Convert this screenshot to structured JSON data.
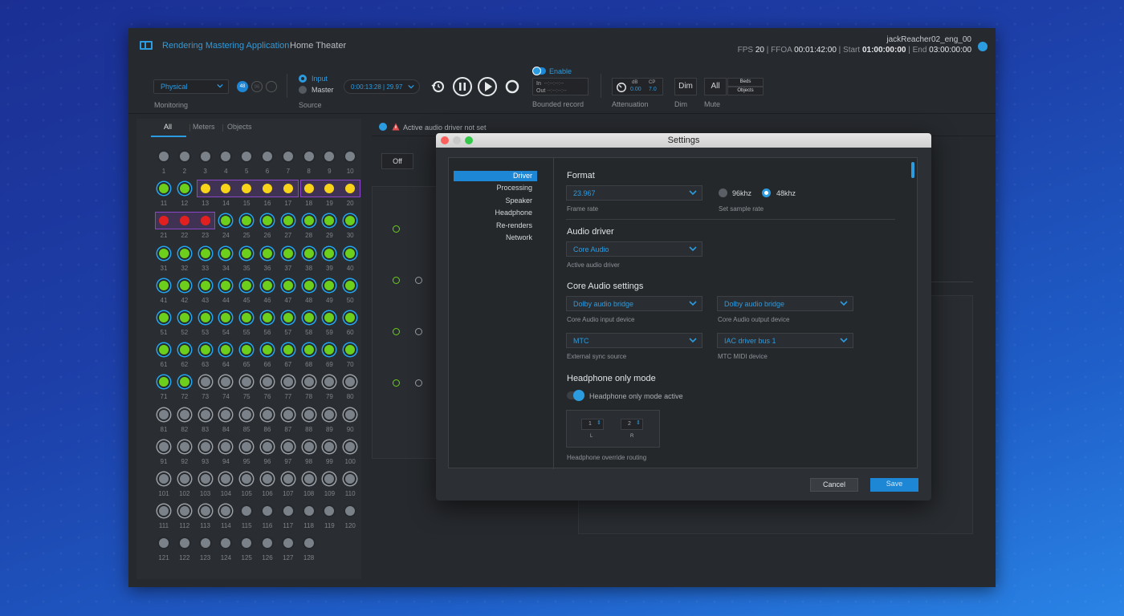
{
  "app": {
    "title": "Rendering Mastering Application",
    "mode": "Home Theater",
    "project": "jackReacher02_eng_00",
    "fps_label": "FPS",
    "fps": "20",
    "ffoa_label": "FFOA",
    "ffoa": "00:01:42:00",
    "start_label": "Start",
    "start": "01:00:00:00",
    "end_label": "End",
    "end": "03:00:00:00"
  },
  "toolbar": {
    "monitoring_value": "Physical",
    "monitoring_label": "Monitoring",
    "rate_badges": [
      "48",
      "96",
      "·"
    ],
    "source_input": "Input",
    "source_master": "Master",
    "source_label": "Source",
    "timecode": "0:00:13:28 | 29.97",
    "enable_label": "Enable",
    "in_label": "In",
    "in_value": "--:--:--:--",
    "out_label": "Out",
    "out_value": "--:--:--:--",
    "bounded_label": "Bounded record",
    "atten_db_label": "dB",
    "atten_db": "0.00",
    "atten_cp_label": "CP",
    "atten_cp": "7.0",
    "attenuation_label": "Attenuation",
    "dim_button": "Dim",
    "dim_label": "Dim",
    "all_button": "All",
    "beds_label": "Beds",
    "objects_label": "Objects",
    "mute_label": "Mute"
  },
  "left_tabs": [
    "All",
    "Meters",
    "Objects"
  ],
  "notice": "Active audio driver not set",
  "off_button": "Off",
  "channels": {
    "plain": [
      1,
      2,
      3,
      4,
      5,
      6,
      7,
      8,
      9,
      10,
      115,
      116,
      117,
      118,
      119,
      120,
      121,
      122,
      123,
      124,
      125,
      126,
      127,
      128
    ],
    "green": [
      11,
      12,
      24,
      25,
      26,
      27,
      28,
      29,
      30,
      31,
      32,
      33,
      34,
      35,
      36,
      37,
      38,
      39,
      40,
      41,
      42,
      43,
      44,
      45,
      46,
      47,
      48,
      49,
      50,
      51,
      52,
      53,
      54,
      55,
      56,
      57,
      58,
      59,
      60,
      61,
      62,
      63,
      64,
      65,
      66,
      67,
      68,
      69,
      70,
      71,
      72
    ],
    "yellow": [
      13,
      14,
      15,
      16,
      17,
      18,
      19,
      20
    ],
    "red": [
      21,
      22,
      23
    ],
    "count": 128
  },
  "settings": {
    "title": "Settings",
    "nav": [
      "Driver",
      "Processing",
      "Speaker",
      "Headphone",
      "Re-renders",
      "Network"
    ],
    "format_heading": "Format",
    "frame_rate_value": "23.967",
    "frame_rate_label": "Frame rate",
    "rate_96": "96khz",
    "rate_48": "48khz",
    "sample_rate_label": "Set sample rate",
    "audio_driver_heading": "Audio driver",
    "audio_driver_value": "Core Audio",
    "audio_driver_label": "Active audio driver",
    "core_heading": "Core Audio settings",
    "input_device_value": "Dolby audio bridge",
    "input_device_label": "Core Audio input device",
    "output_device_value": "Dolby audio bridge",
    "output_device_label": "Core Audio output device",
    "sync_value": "MTC",
    "sync_label": "External sync source",
    "midi_value": "IAC driver bus 1",
    "midi_label": "MTC MIDI device",
    "headphone_heading": "Headphone only mode",
    "headphone_toggle_label": "Headphone only mode active",
    "routing_l_value": "1",
    "routing_r_value": "2",
    "routing_l_label": "L",
    "routing_r_label": "R",
    "routing_label": "Headphone override routing",
    "cancel": "Cancel",
    "save": "Save"
  },
  "colors": {
    "accent": "#2c9ce0",
    "green": "#6ccf1c",
    "yellow": "#f7d31a",
    "red": "#e32020",
    "group": "#8b46c9"
  }
}
